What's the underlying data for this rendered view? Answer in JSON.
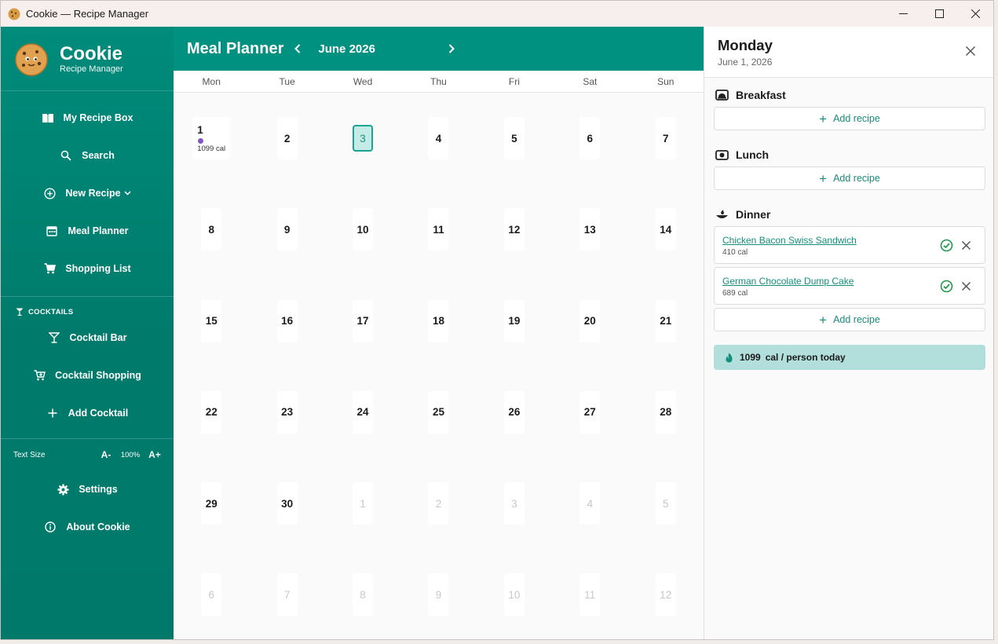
{
  "window": {
    "title": "Cookie — Recipe Manager"
  },
  "sidebar": {
    "brand_name": "Cookie",
    "brand_sub": "Recipe Manager",
    "nav": [
      {
        "label": "My Recipe Box",
        "icon": "book-icon"
      },
      {
        "label": "Search",
        "icon": "search-icon"
      },
      {
        "label": "New Recipe",
        "icon": "add-circle-icon"
      },
      {
        "label": "Meal Planner",
        "icon": "calendar-icon"
      },
      {
        "label": "Shopping List",
        "icon": "cart-icon"
      }
    ],
    "cocktails_label": "COCKTAILS",
    "cocktails": [
      {
        "label": "Cocktail Bar",
        "icon": "martini-icon"
      },
      {
        "label": "Cocktail Shopping",
        "icon": "cart-plus-icon"
      },
      {
        "label": "Add Cocktail",
        "icon": "plus-icon"
      }
    ],
    "text_size": {
      "label": "Text Size",
      "decrease": "A-",
      "value": "100%",
      "increase": "A+"
    },
    "bottom": [
      {
        "label": "Settings",
        "icon": "gear-icon"
      },
      {
        "label": "About Cookie",
        "icon": "info-icon"
      }
    ]
  },
  "planner": {
    "title": "Meal Planner",
    "month": "June 2026",
    "weekdays": [
      "Mon",
      "Tue",
      "Wed",
      "Thu",
      "Fri",
      "Sat",
      "Sun"
    ],
    "days": [
      {
        "n": "1",
        "meal_cal": "1099 cal"
      },
      {
        "n": "2"
      },
      {
        "n": "3",
        "today": true
      },
      {
        "n": "4"
      },
      {
        "n": "5"
      },
      {
        "n": "6"
      },
      {
        "n": "7"
      },
      {
        "n": "8"
      },
      {
        "n": "9"
      },
      {
        "n": "10"
      },
      {
        "n": "11"
      },
      {
        "n": "12"
      },
      {
        "n": "13"
      },
      {
        "n": "14"
      },
      {
        "n": "15"
      },
      {
        "n": "16"
      },
      {
        "n": "17"
      },
      {
        "n": "18"
      },
      {
        "n": "19"
      },
      {
        "n": "20"
      },
      {
        "n": "21"
      },
      {
        "n": "22"
      },
      {
        "n": "23"
      },
      {
        "n": "24"
      },
      {
        "n": "25"
      },
      {
        "n": "26"
      },
      {
        "n": "27"
      },
      {
        "n": "28"
      },
      {
        "n": "29"
      },
      {
        "n": "30"
      },
      {
        "n": "1",
        "other": true
      },
      {
        "n": "2",
        "other": true
      },
      {
        "n": "3",
        "other": true
      },
      {
        "n": "4",
        "other": true
      },
      {
        "n": "5",
        "other": true
      },
      {
        "n": "6",
        "other": true
      },
      {
        "n": "7",
        "other": true
      },
      {
        "n": "8",
        "other": true
      },
      {
        "n": "9",
        "other": true
      },
      {
        "n": "10",
        "other": true
      },
      {
        "n": "11",
        "other": true
      },
      {
        "n": "12",
        "other": true
      }
    ]
  },
  "detail": {
    "day_name": "Monday",
    "date": "June 1, 2026",
    "add_label": "Add recipe",
    "breakfast": {
      "label": "Breakfast"
    },
    "lunch": {
      "label": "Lunch"
    },
    "dinner": {
      "label": "Dinner",
      "recipes": [
        {
          "name": "Chicken Bacon Swiss Sandwich",
          "cal": "410 cal"
        },
        {
          "name": "German Chocolate Dump Cake",
          "cal": "689 cal"
        }
      ]
    },
    "total": {
      "value": "1099",
      "unit": "cal / person today"
    }
  },
  "colors": {
    "sidebar": "#00836f",
    "header": "#009180",
    "accent": "#13907c",
    "total_bg": "#b2dfdb",
    "meal_dot": "#7e57c2"
  }
}
